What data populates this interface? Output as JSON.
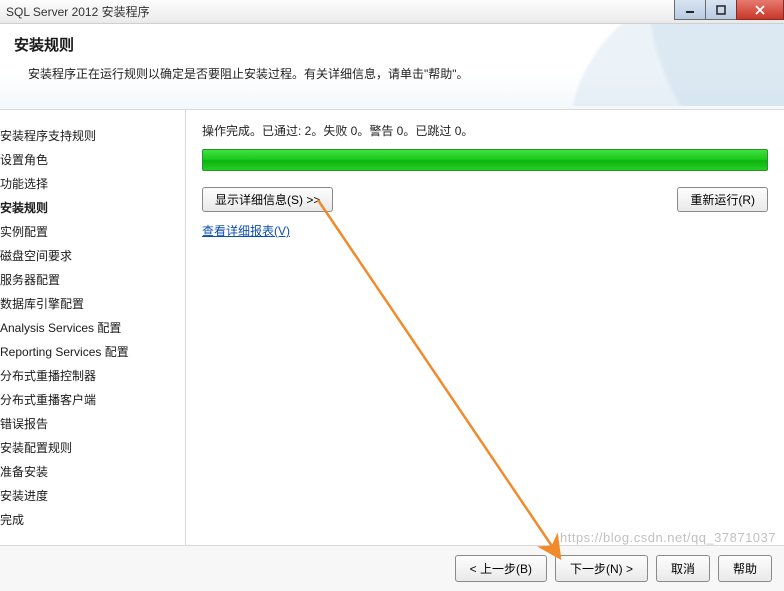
{
  "window": {
    "title": "SQL Server 2012 安装程序"
  },
  "header": {
    "title": "安装规则",
    "subtitle": "安装程序正在运行规则以确定是否要阻止安装过程。有关详细信息，请单击\"帮助\"。"
  },
  "sidebar": {
    "items": [
      {
        "label": "安装程序支持规则",
        "active": false
      },
      {
        "label": "设置角色",
        "active": false
      },
      {
        "label": "功能选择",
        "active": false
      },
      {
        "label": "安装规则",
        "active": true
      },
      {
        "label": "实例配置",
        "active": false
      },
      {
        "label": "磁盘空间要求",
        "active": false
      },
      {
        "label": "服务器配置",
        "active": false
      },
      {
        "label": "数据库引擎配置",
        "active": false
      },
      {
        "label": "Analysis Services 配置",
        "active": false
      },
      {
        "label": "Reporting Services 配置",
        "active": false
      },
      {
        "label": "分布式重播控制器",
        "active": false
      },
      {
        "label": "分布式重播客户端",
        "active": false
      },
      {
        "label": "错误报告",
        "active": false
      },
      {
        "label": "安装配置规则",
        "active": false
      },
      {
        "label": "准备安装",
        "active": false
      },
      {
        "label": "安装进度",
        "active": false
      },
      {
        "label": "完成",
        "active": false
      }
    ]
  },
  "content": {
    "status": "操作完成。已通过: 2。失败 0。警告 0。已跳过 0。",
    "show_details": "显示详细信息(S) >>",
    "rerun": "重新运行(R)",
    "view_report": "查看详细报表(V)"
  },
  "footer": {
    "back": "< 上一步(B)",
    "next": "下一步(N) >",
    "cancel": "取消",
    "help": "帮助"
  },
  "watermark": "https://blog.csdn.net/qq_37871037"
}
